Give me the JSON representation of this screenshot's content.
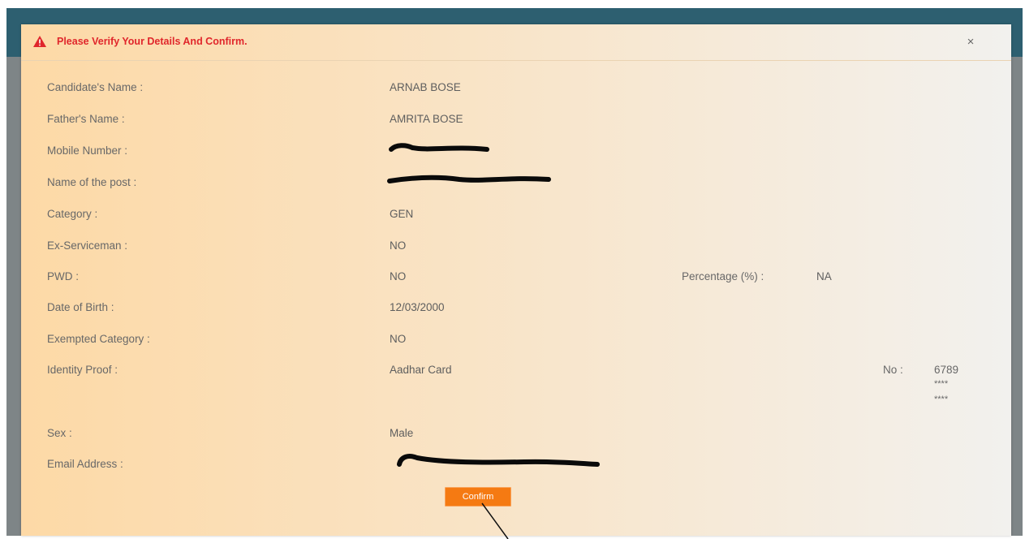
{
  "dialog": {
    "title": "Please Verify Your Details And Confirm.",
    "close_symbol": "×",
    "warning_icon": "warning-triangle-icon",
    "accent_color": "#e0262b"
  },
  "fields": {
    "candidate_name": {
      "label": "Candidate's Name :",
      "value": "ARNAB BOSE"
    },
    "father_name": {
      "label": "Father's Name :",
      "value": "AMRITA BOSE"
    },
    "mobile_number": {
      "label": "Mobile Number :",
      "value": ""
    },
    "post_name": {
      "label": "Name of the post :",
      "value": ""
    },
    "category": {
      "label": "Category :",
      "value": "GEN"
    },
    "ex_serviceman": {
      "label": "Ex-Serviceman :",
      "value": "NO"
    },
    "pwd": {
      "label": "PWD :",
      "value": "NO"
    },
    "pwd_percentage": {
      "label": "Percentage (%) :",
      "value": "NA"
    },
    "date_of_birth": {
      "label": "Date of Birth :",
      "value": "12/03/2000"
    },
    "exempted_category": {
      "label": "Exempted Category :",
      "value": "NO"
    },
    "identity_proof": {
      "label": "Identity Proof :",
      "value": "Aadhar Card",
      "number_label": "No :",
      "number_line1": "6789",
      "number_line2": "****",
      "number_line3": "****"
    },
    "sex": {
      "label": "Sex :",
      "value": "Male"
    },
    "email_address": {
      "label": "Email Address :",
      "value": ""
    }
  },
  "actions": {
    "confirm_label": "Confirm",
    "confirm_color": "#f57a12"
  }
}
